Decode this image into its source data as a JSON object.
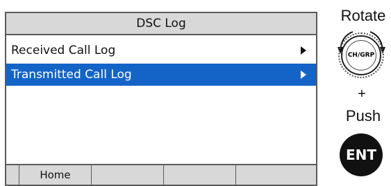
{
  "screen": {
    "title": "DSC Log",
    "items": [
      {
        "label": "Received Call Log",
        "selected": false
      },
      {
        "label": "Transmitted Call Log",
        "selected": true
      }
    ],
    "softkeys": [
      "Home",
      "",
      "",
      ""
    ]
  },
  "controls": {
    "rotate_label": "Rotate",
    "knob_label": "CH/GRP",
    "plus_label": "+",
    "push_label": "Push",
    "ent_label": "ENT"
  },
  "colors": {
    "selected_bg": "#1464c8",
    "bar_bg": "#d8d8d8"
  }
}
